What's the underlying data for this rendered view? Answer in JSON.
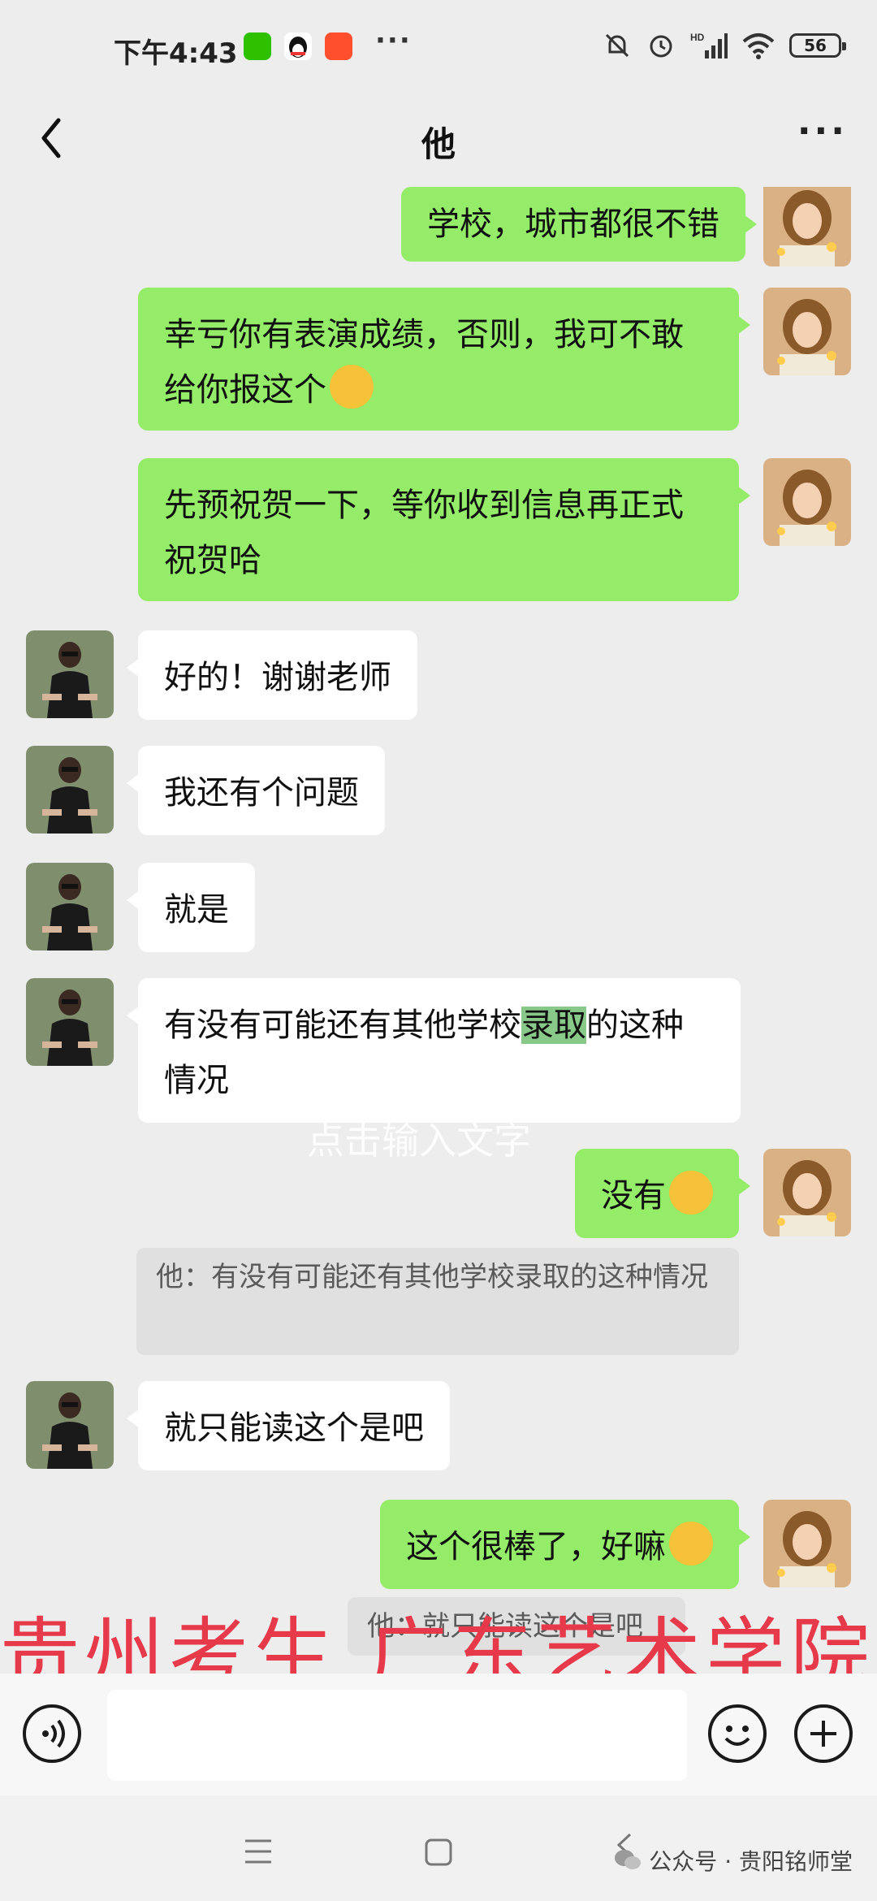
{
  "status_bar": {
    "time": "下午4:43",
    "more": "···",
    "battery": "56",
    "icons": [
      "wechat-icon",
      "qq-icon",
      "taobao-icon",
      "mute-icon",
      "alarm-icon",
      "signal-icon",
      "wifi-icon",
      "battery-icon"
    ]
  },
  "header": {
    "title": "他",
    "back_icon": "chevron-left-icon",
    "more_label": "···"
  },
  "messages": [
    {
      "side": "me",
      "text": "学校，城市都很不错"
    },
    {
      "side": "me",
      "text": "幸亏你有表演成绩，否则，我可不敢给你报这个",
      "emoji": "thinking-face"
    },
    {
      "side": "me",
      "text": "先预祝贺一下，等你收到信息再正式祝贺哈"
    },
    {
      "side": "them",
      "text": "好的！谢谢老师"
    },
    {
      "side": "them",
      "text": "我还有个问题"
    },
    {
      "side": "them",
      "text": "就是"
    },
    {
      "side": "them",
      "text_before": "有没有可能还有其他学校",
      "text_highlight": "录取",
      "text_after": "的这种情况"
    },
    {
      "side": "me",
      "text": "没有",
      "emoji": "grinning-face"
    },
    {
      "side": "quote",
      "text": "他：有没有可能还有其他学校录取的这种情况"
    },
    {
      "side": "them",
      "text": "就只能读这个是吧"
    },
    {
      "side": "me",
      "text": "这个很棒了，好嘛",
      "emoji": "grinning-face"
    },
    {
      "side": "quote",
      "text": "他：就只能读这个是吧"
    }
  ],
  "watermark_center": "点击输入文字",
  "overlay_caption": "贵州考生  广东艺术学院",
  "input_bar": {
    "voice_icon": "voice-icon",
    "emoji_icon": "emoji-icon",
    "plus_icon": "plus-icon",
    "value": ""
  },
  "nav_bar": {
    "icons": [
      "menu-icon",
      "home-icon",
      "back-icon"
    ],
    "brand": "公众号 · 贵阳铭师堂"
  },
  "colors": {
    "me_bubble": "#95ec69",
    "them_bubble": "#ffffff",
    "background": "#ededed",
    "highlight": "#88c98a",
    "overlay_text": "#e63a4a"
  }
}
